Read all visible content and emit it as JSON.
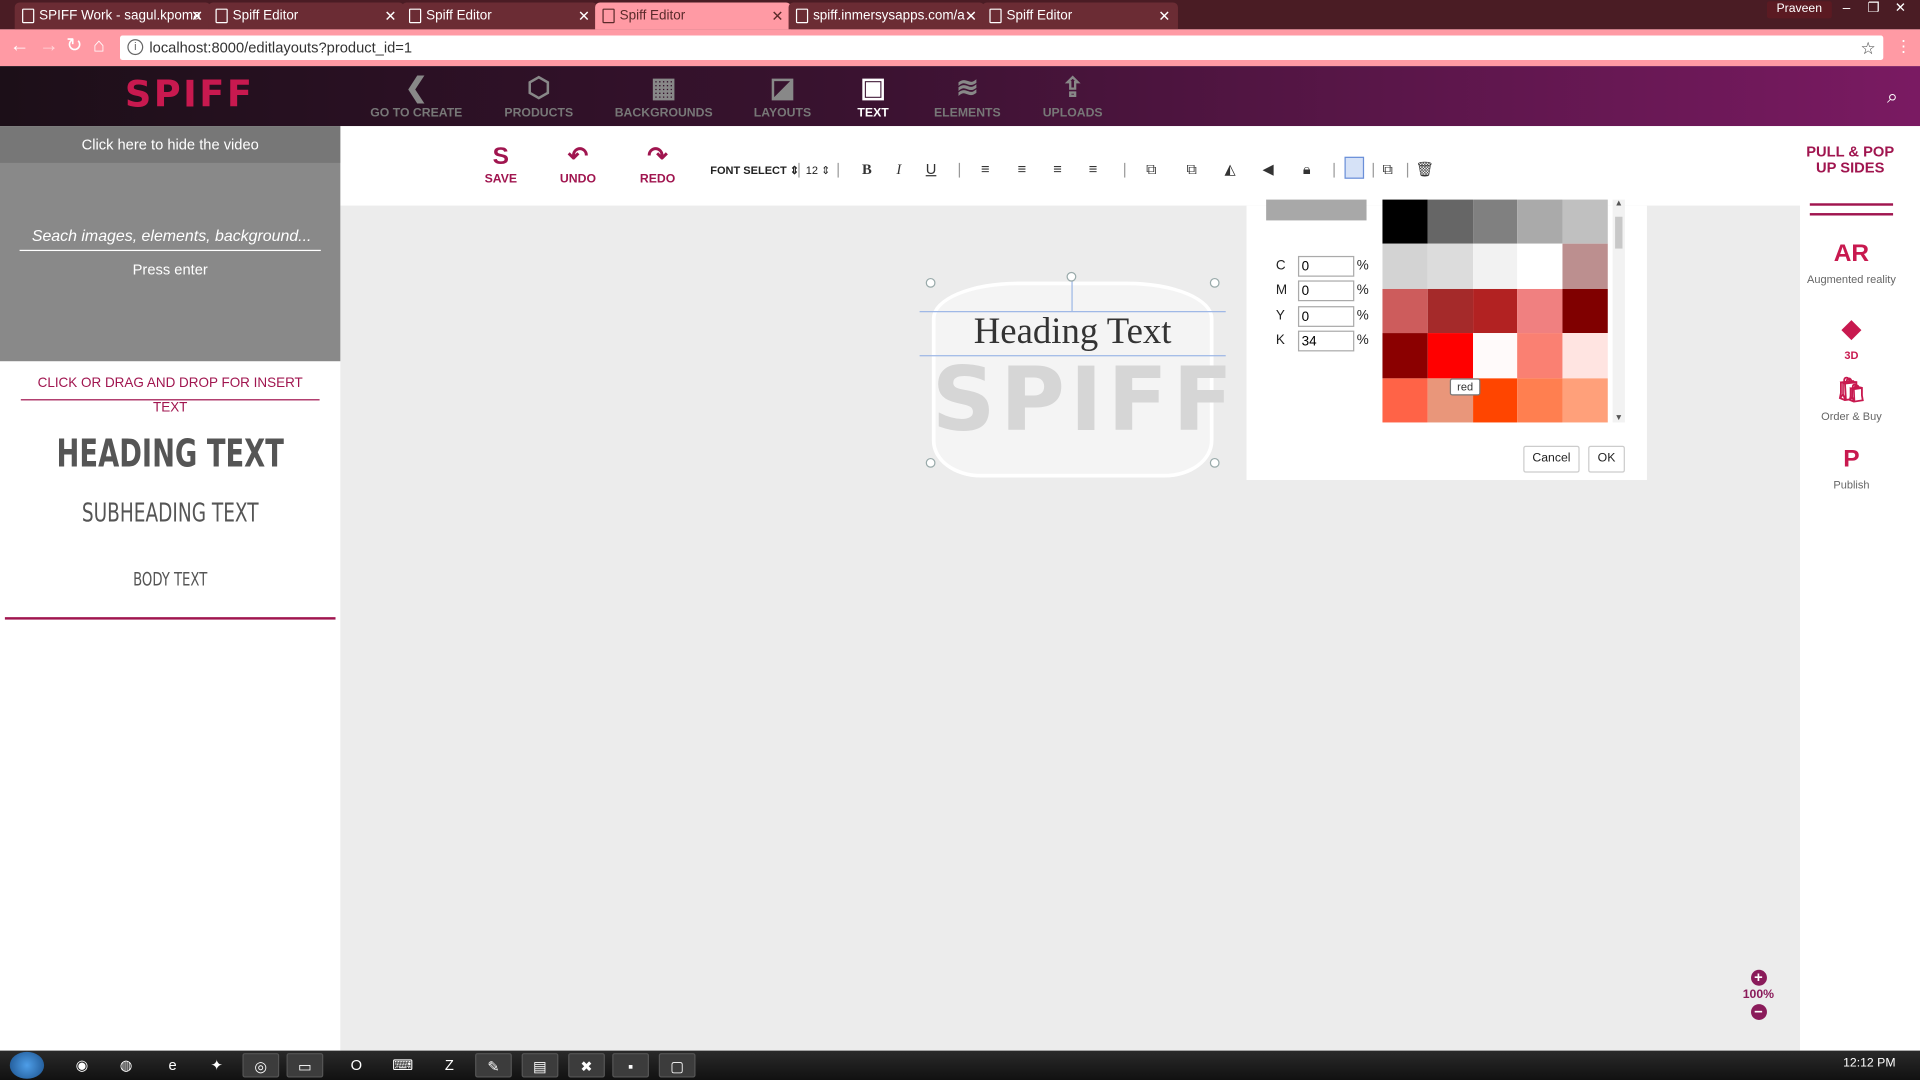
{
  "browser": {
    "tabs": [
      {
        "label": "SPIFF Work - sagul.kpoma",
        "active": false
      },
      {
        "label": "Spiff Editor",
        "active": false
      },
      {
        "label": "Spiff Editor",
        "active": false
      },
      {
        "label": "Spiff Editor",
        "active": true
      },
      {
        "label": "spiff.inmersysapps.com/a",
        "active": false
      },
      {
        "label": "Spiff Editor",
        "active": false
      }
    ],
    "profile_name": "Praveen",
    "url": "localhost:8000/editlayouts?product_id=1"
  },
  "app": {
    "logo": "SPIFF",
    "nav": [
      {
        "label": "GO TO CREATE",
        "icon": "chevron-left-icon",
        "active": false
      },
      {
        "label": "PRODUCTS",
        "icon": "cube-icon",
        "active": false
      },
      {
        "label": "BACKGROUNDS",
        "icon": "pattern-icon",
        "active": false
      },
      {
        "label": "LAYOUTS",
        "icon": "layouts-icon",
        "active": false
      },
      {
        "label": "TEXT",
        "icon": "text-icon",
        "active": true
      },
      {
        "label": "ELEMENTS",
        "icon": "elements-icon",
        "active": false
      },
      {
        "label": "UPLOADS",
        "icon": "upload-icon",
        "active": false
      }
    ]
  },
  "left_panel": {
    "hide_video": "Click here to hide the video",
    "search_placeholder": "Seach images, elements, background...",
    "press_enter": "Press enter",
    "insert_hint": "CLICK OR DRAG AND DROP FOR INSERT TEXT",
    "samples": {
      "heading": "HEADING TEXT",
      "subheading": "SUBHEADING TEXT",
      "body": "BODY TEXT"
    }
  },
  "toolbar": {
    "save": "SAVE",
    "undo": "UNDO",
    "redo": "REDO",
    "font_select": "FONT SELECT",
    "font_size": "12"
  },
  "canvas": {
    "heading_text": "Heading Text",
    "watermark": "SPIFF"
  },
  "color_picker": {
    "cmyk": [
      {
        "label": "C",
        "value": "0"
      },
      {
        "label": "M",
        "value": "0"
      },
      {
        "label": "Y",
        "value": "0"
      },
      {
        "label": "K",
        "value": "34"
      }
    ],
    "percent": "%",
    "tooltip": "red",
    "cancel": "Cancel",
    "ok": "OK",
    "preview_color": "#a8a8a8",
    "swatches": [
      "#000000",
      "#666666",
      "#808080",
      "#aaaaaa",
      "#c0c0c0",
      "#d3d3d3",
      "#dcdcdc",
      "#f2f2f2",
      "#ffffff",
      "#bc8f8f",
      "#cd5c5c",
      "#a52a2a",
      "#b22222",
      "#f08080",
      "#800000",
      "#8b0000",
      "#ff0000",
      "#fffafa",
      "#fa8072",
      "#ffe4e1",
      "#ff6347",
      "#e9967a",
      "#ff4500",
      "#ff7f50",
      "#ffa07a"
    ]
  },
  "right_panel": {
    "pull_pop": "PULL & POP UP SIDES",
    "items": [
      {
        "label": "Augmented reality",
        "icon_text": "AR"
      },
      {
        "label": "3D",
        "icon_text": ""
      },
      {
        "label": "Order & Buy",
        "icon_text": ""
      },
      {
        "label": "Publish",
        "icon_text": "P"
      }
    ]
  },
  "zoom": {
    "level": "100%"
  },
  "taskbar": {
    "time": "12:12 PM"
  }
}
